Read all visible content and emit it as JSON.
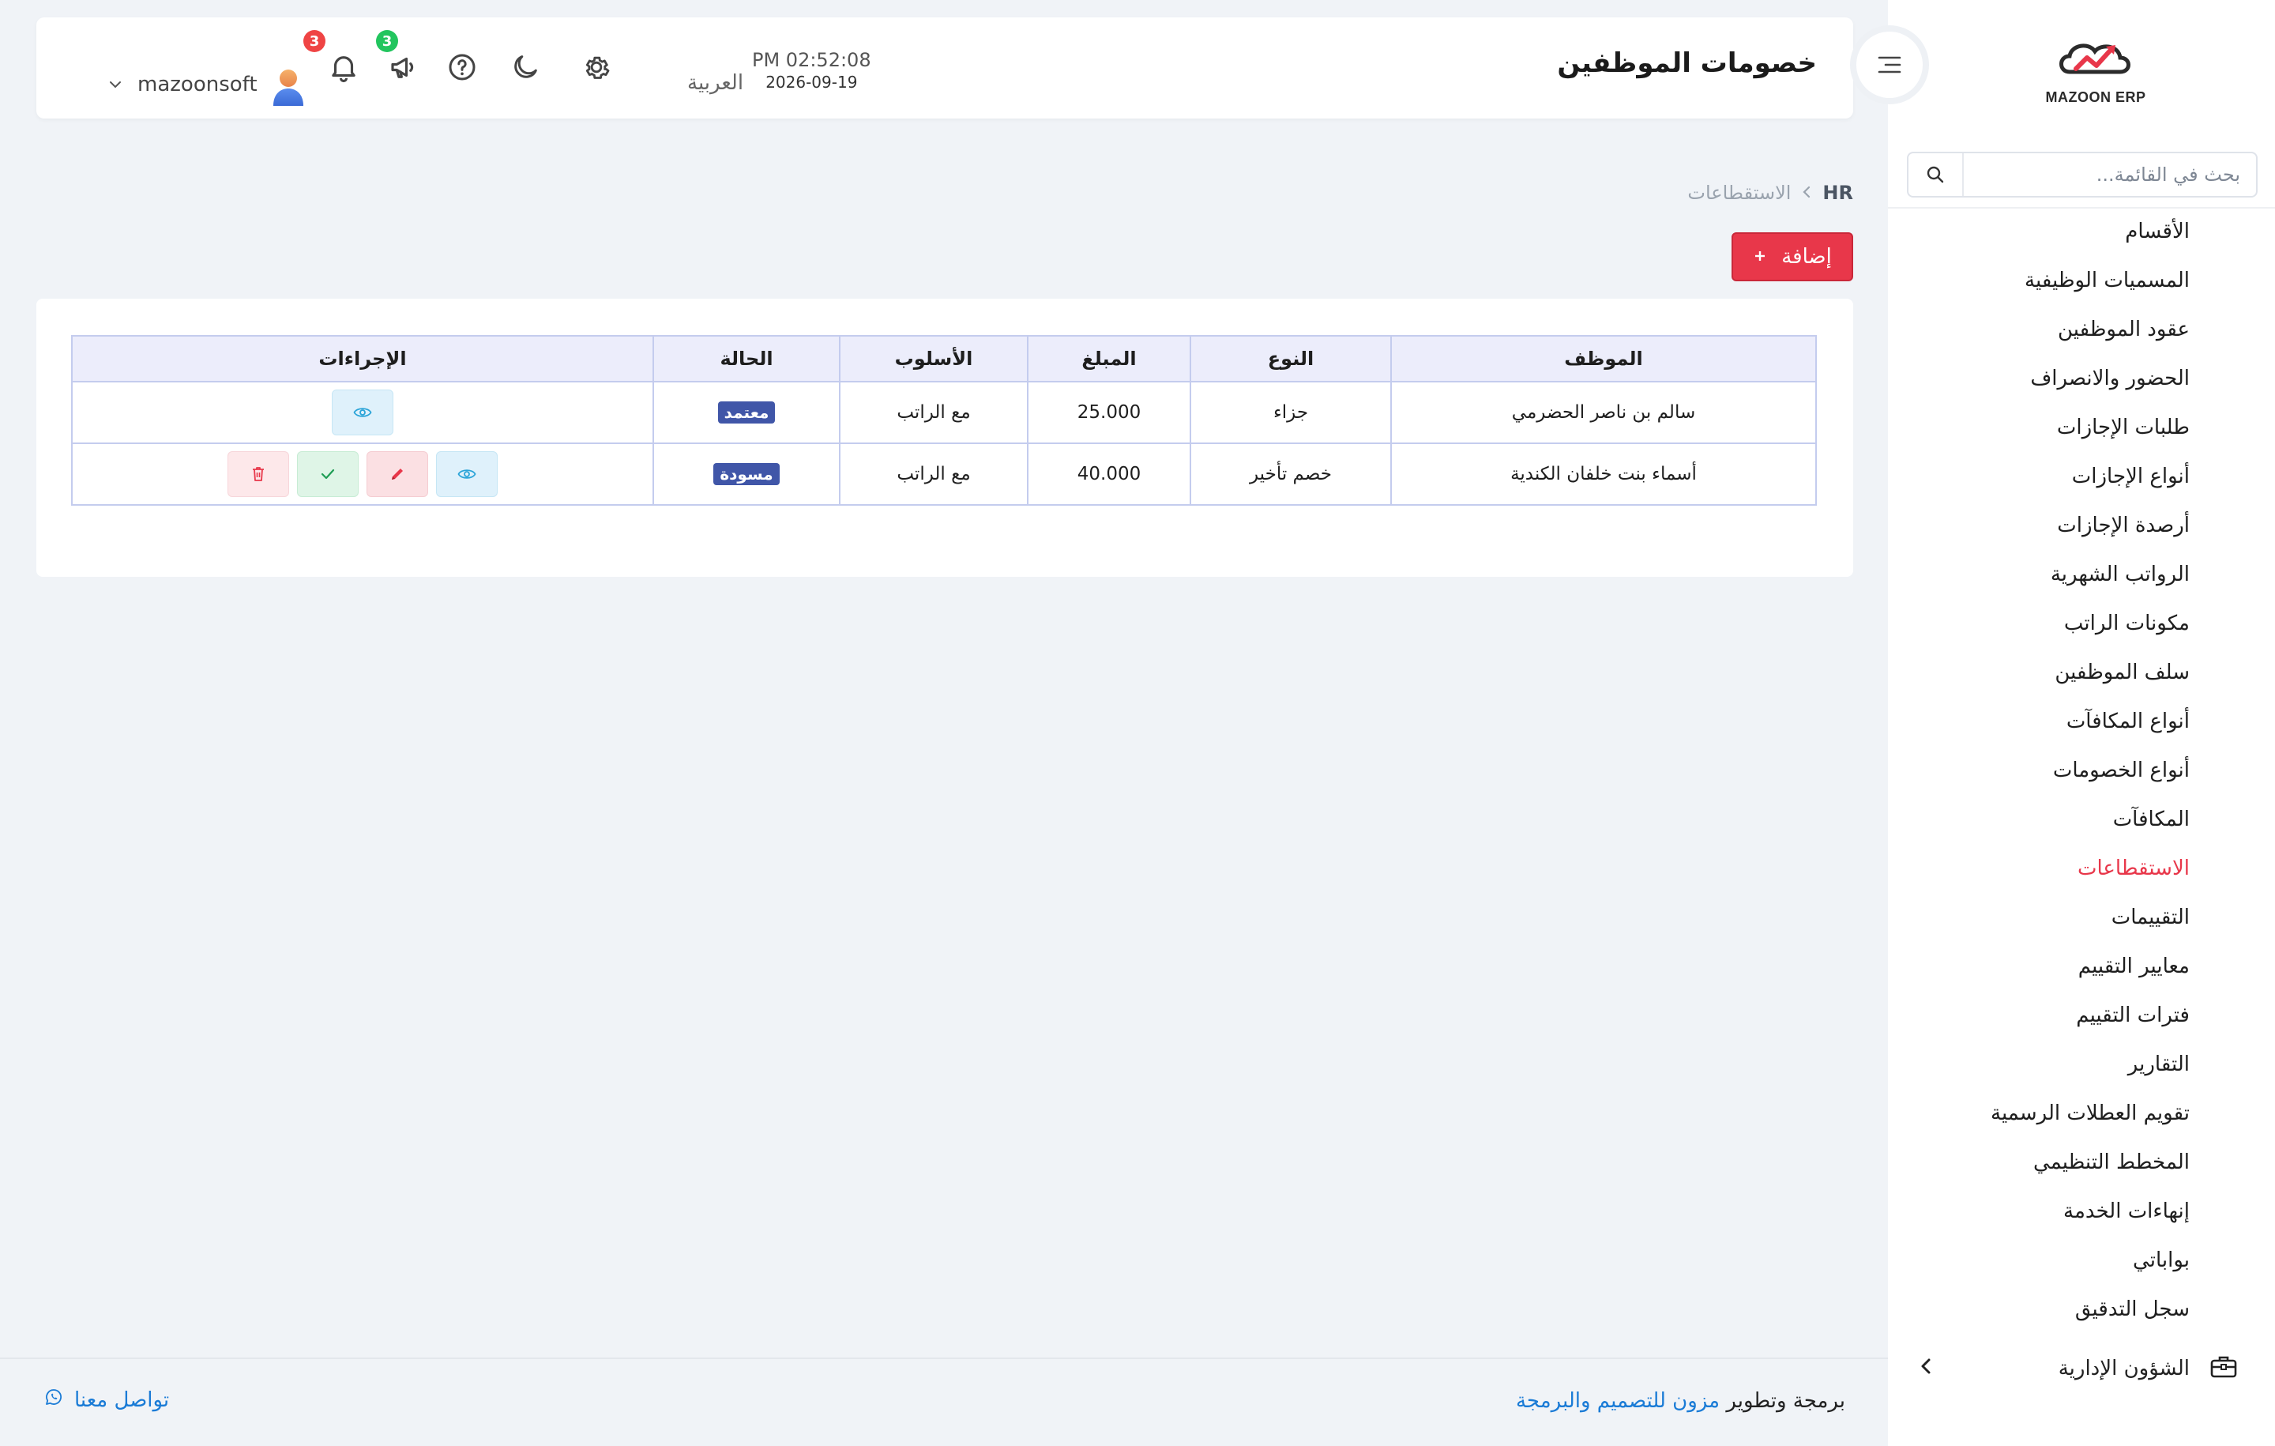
{
  "sidebar": {
    "logo_text": "MAZOON ERP",
    "search_placeholder": "بحث في القائمة...",
    "items": [
      {
        "label": "الأقسام"
      },
      {
        "label": "المسميات الوظيفية"
      },
      {
        "label": "عقود الموظفين"
      },
      {
        "label": "الحضور والانصراف"
      },
      {
        "label": "طلبات الإجازات"
      },
      {
        "label": "أنواع الإجازات"
      },
      {
        "label": "أرصدة الإجازات"
      },
      {
        "label": "الرواتب الشهرية"
      },
      {
        "label": "مكونات الراتب"
      },
      {
        "label": "سلف الموظفين"
      },
      {
        "label": "أنواع المكافآت"
      },
      {
        "label": "أنواع الخصومات"
      },
      {
        "label": "المكافآت"
      },
      {
        "label": "الاستقطاعات",
        "active": true
      },
      {
        "label": "التقييمات"
      },
      {
        "label": "معايير التقييم"
      },
      {
        "label": "فترات التقييم"
      },
      {
        "label": "التقارير"
      },
      {
        "label": "تقويم العطلات الرسمية"
      },
      {
        "label": "المخطط التنظيمي"
      },
      {
        "label": "إنهاءات الخدمة"
      },
      {
        "label": "بواباتي"
      },
      {
        "label": "سجل التدقيق"
      }
    ],
    "group_label": "الشؤون الإدارية"
  },
  "header": {
    "title": "خصومات الموظفين",
    "time": "PM 02:52:08",
    "date": "2026-09-19",
    "language": "العربية",
    "announcements_count": "3",
    "notifications_count": "3",
    "username": "mazoonsoft"
  },
  "breadcrumb": {
    "root": "HR",
    "current": "الاستقطاعات"
  },
  "add_button": {
    "label": "إضافة"
  },
  "table": {
    "headers": {
      "employee": "الموظف",
      "type": "النوع",
      "amount": "المبلغ",
      "method": "الأسلوب",
      "status": "الحالة",
      "actions": "الإجراءات"
    },
    "rows": [
      {
        "employee": "سالم بن ناصر الحضرمي",
        "type": "جزاء",
        "amount": "25.000",
        "method": "مع الراتب",
        "status": "معتمد"
      },
      {
        "employee": "أسماء بنت خلفان الكندية",
        "type": "خصم تأخير",
        "amount": "40.000",
        "method": "مع الراتب",
        "status": "مسودة"
      }
    ]
  },
  "footer": {
    "credit_prefix": "برمجة وتطوير",
    "credit_link": "مزون للتصميم والبرمجة",
    "contact": "تواصل معنا"
  },
  "colors": {
    "accent": "#e8374a",
    "link": "#1a7bd6",
    "status_badge": "#4056a8",
    "notification_badge": "#ef4444",
    "announcement_badge": "#22c55e"
  }
}
